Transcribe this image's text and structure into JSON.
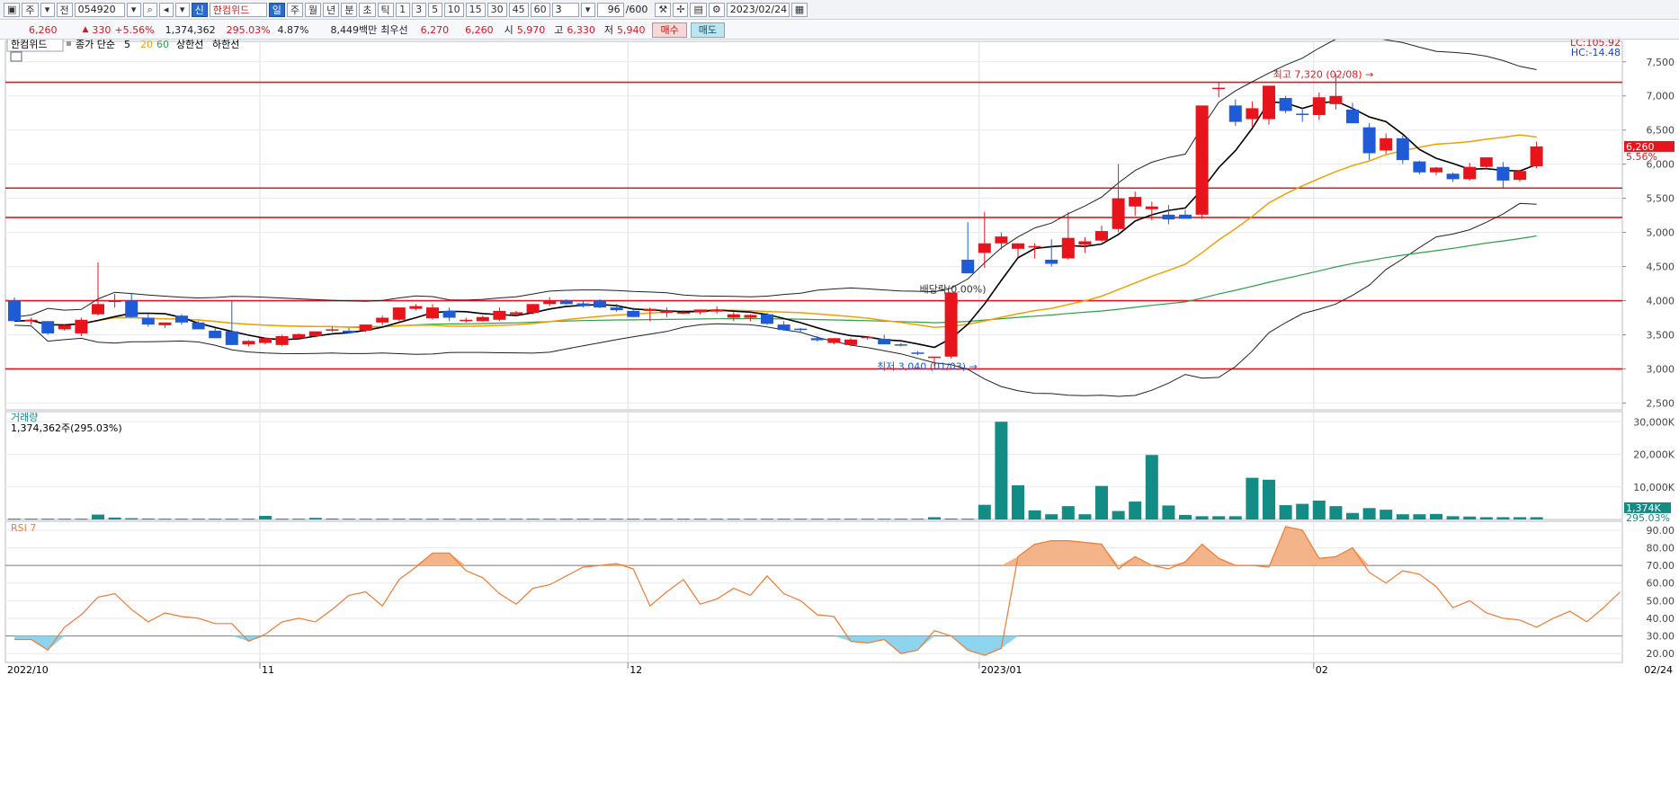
{
  "toolbar": {
    "period_label": "주",
    "jeon_label": "전",
    "code": "054920",
    "sin_label": "신",
    "name": "한컴위드",
    "timeframes": [
      "일",
      "주",
      "월",
      "년",
      "분",
      "초",
      "틱"
    ],
    "minutes": [
      "1",
      "3",
      "5",
      "10",
      "15",
      "30",
      "45",
      "60"
    ],
    "extra": "3",
    "count": "96",
    "count_total": "/600",
    "date": "2023/02/24"
  },
  "quote": {
    "price": "6,260",
    "change_arrow": "▲",
    "change": "330",
    "change_pct": "+5.56%",
    "volume": "1,374,362",
    "volume_ratio": "295.03%",
    "turnover_ratio": "4.87%",
    "amount": "8,449백만",
    "best_label": "최우선",
    "best_ask": "6,270",
    "best_bid": "6,260",
    "open_label": "시",
    "open": "5,970",
    "high_label": "고",
    "high": "6,330",
    "low_label": "저",
    "low": "5,940",
    "buy_button": "매수",
    "sell_button": "매도"
  },
  "colors": {
    "up": "#e8141c",
    "down": "#1f5bd6",
    "ma5": "#000000",
    "ma20": "#f0a000",
    "ma60": "#2e9e4a",
    "band": "#222222",
    "level_line": "#e8141c",
    "volume": "#148c86",
    "rsi": "#f07a30",
    "rsi_over": "#f4b48a",
    "rsi_under": "#8fd4ee"
  },
  "chart_data": {
    "type": "candlestick",
    "legend": {
      "name": "한컴위드",
      "ma_label": "종가 단순",
      "ma_periods": [
        "5",
        "20",
        "60"
      ],
      "upper": "상한선",
      "lower": "하한선"
    },
    "corner": {
      "lc": "LC:105.92",
      "hc": "HC:-14.48"
    },
    "price_axis": {
      "min": 2400,
      "max": 7800,
      "ticks": [
        2500,
        3000,
        3500,
        4000,
        4500,
        5000,
        5500,
        6000,
        6500,
        7000,
        7500
      ],
      "tick_labels": [
        "2,500",
        "3,000",
        "3,500",
        "4,000",
        "4,500",
        "5,000",
        "5,500",
        "6,000",
        "6,500",
        "7,000",
        "7,500"
      ]
    },
    "current_tag": {
      "price": 6260,
      "label": "6,260",
      "pct": "5.56%"
    },
    "x_labels": [
      {
        "label": "2022/10",
        "index": 0
      },
      {
        "label": "11",
        "index": 15
      },
      {
        "label": "12",
        "index": 37
      },
      {
        "label": "2023/01",
        "index": 58
      },
      {
        "label": "02",
        "index": 78
      },
      {
        "label": "02/24",
        "index": 97
      }
    ],
    "level_lines": [
      7200,
      5650,
      5220,
      4000,
      3000
    ],
    "annotations": {
      "high": {
        "text": "최고 7,320 (02/08) →",
        "index": 76,
        "price": 7320
      },
      "low": {
        "text": "최저 3,040 (01/03) →",
        "index": 58,
        "price": 3040
      },
      "dividend": {
        "text": "배당락(0.00%)",
        "index": 56,
        "price": 4120
      }
    },
    "candles": [
      [
        4000,
        4050,
        3700,
        3700
      ],
      [
        3700,
        3750,
        3650,
        3720
      ],
      [
        3700,
        3700,
        3500,
        3520
      ],
      [
        3580,
        3650,
        3560,
        3640
      ],
      [
        3520,
        3750,
        3480,
        3720
      ],
      [
        3800,
        4560,
        3780,
        3950
      ],
      [
        3980,
        4100,
        3900,
        4000
      ],
      [
        4000,
        4100,
        3750,
        3760
      ],
      [
        3750,
        3800,
        3620,
        3650
      ],
      [
        3640,
        3680,
        3600,
        3680
      ],
      [
        3780,
        3800,
        3650,
        3680
      ],
      [
        3680,
        3700,
        3580,
        3580
      ],
      [
        3560,
        3600,
        3450,
        3450
      ],
      [
        3550,
        4000,
        3350,
        3350
      ],
      [
        3360,
        3420,
        3330,
        3410
      ],
      [
        3380,
        3450,
        3360,
        3450
      ],
      [
        3350,
        3500,
        3330,
        3480
      ],
      [
        3450,
        3520,
        3440,
        3510
      ],
      [
        3480,
        3550,
        3460,
        3550
      ],
      [
        3560,
        3620,
        3540,
        3580
      ],
      [
        3560,
        3600,
        3520,
        3530
      ],
      [
        3560,
        3650,
        3540,
        3650
      ],
      [
        3680,
        3780,
        3640,
        3750
      ],
      [
        3720,
        3900,
        3700,
        3900
      ],
      [
        3880,
        3950,
        3860,
        3920
      ],
      [
        3740,
        3950,
        3720,
        3900
      ],
      [
        3850,
        3900,
        3700,
        3750
      ],
      [
        3700,
        3750,
        3680,
        3720
      ],
      [
        3700,
        3780,
        3690,
        3760
      ],
      [
        3720,
        3900,
        3700,
        3850
      ],
      [
        3800,
        3850,
        3780,
        3830
      ],
      [
        3820,
        3950,
        3800,
        3950
      ],
      [
        3950,
        4050,
        3920,
        4000
      ],
      [
        4000,
        4020,
        3940,
        3950
      ],
      [
        3960,
        4000,
        3900,
        3920
      ],
      [
        4000,
        4020,
        3890,
        3900
      ],
      [
        3900,
        3950,
        3840,
        3860
      ],
      [
        3850,
        3900,
        3760,
        3760
      ],
      [
        3850,
        3900,
        3700,
        3880
      ],
      [
        3820,
        3900,
        3760,
        3860
      ],
      [
        3830,
        3860,
        3800,
        3830
      ],
      [
        3830,
        3870,
        3800,
        3870
      ],
      [
        3840,
        3920,
        3810,
        3870
      ],
      [
        3750,
        3830,
        3700,
        3800
      ],
      [
        3750,
        3800,
        3700,
        3790
      ],
      [
        3800,
        3820,
        3650,
        3660
      ],
      [
        3650,
        3700,
        3560,
        3570
      ],
      [
        3590,
        3600,
        3550,
        3570
      ],
      [
        3450,
        3480,
        3400,
        3420
      ],
      [
        3380,
        3450,
        3360,
        3450
      ],
      [
        3350,
        3450,
        3330,
        3430
      ],
      [
        3460,
        3480,
        3430,
        3470
      ],
      [
        3440,
        3500,
        3360,
        3360
      ],
      [
        3360,
        3380,
        3330,
        3350
      ],
      [
        3240,
        3260,
        3200,
        3220
      ],
      [
        3160,
        3180,
        3040,
        3180
      ],
      [
        3180,
        4100,
        3150,
        4120
      ],
      [
        4600,
        5150,
        4500,
        4400
      ],
      [
        4700,
        5300,
        4480,
        4840
      ],
      [
        4840,
        5000,
        4750,
        4940
      ],
      [
        4760,
        4800,
        4640,
        4840
      ],
      [
        4780,
        4840,
        4620,
        4800
      ],
      [
        4600,
        4900,
        4500,
        4540
      ],
      [
        4620,
        5300,
        4600,
        4920
      ],
      [
        4820,
        4930,
        4700,
        4870
      ],
      [
        4880,
        5100,
        4860,
        5020
      ],
      [
        5050,
        6000,
        5000,
        5500
      ],
      [
        5380,
        5600,
        5240,
        5520
      ],
      [
        5340,
        5450,
        5180,
        5380
      ],
      [
        5260,
        5400,
        5120,
        5190
      ],
      [
        5260,
        5330,
        5230,
        5200
      ],
      [
        5260,
        5500,
        5200,
        6860
      ],
      [
        7120,
        7200,
        6980,
        7120
      ],
      [
        6860,
        6950,
        6560,
        6620
      ],
      [
        6660,
        6920,
        6550,
        6820
      ],
      [
        6660,
        7150,
        6580,
        7150
      ],
      [
        6970,
        7000,
        6750,
        6780
      ],
      [
        6740,
        6800,
        6620,
        6720
      ],
      [
        6720,
        7050,
        6650,
        6980
      ],
      [
        6880,
        7320,
        6800,
        7000
      ],
      [
        6800,
        6900,
        6600,
        6600
      ],
      [
        6540,
        6600,
        6060,
        6160
      ],
      [
        6200,
        6450,
        6150,
        6380
      ],
      [
        6380,
        6420,
        6000,
        6060
      ],
      [
        6040,
        6050,
        5850,
        5880
      ],
      [
        5880,
        5960,
        5840,
        5950
      ],
      [
        5860,
        5880,
        5740,
        5780
      ],
      [
        5780,
        6020,
        5760,
        5960
      ],
      [
        5960,
        6100,
        5920,
        6100
      ],
      [
        5960,
        6030,
        5650,
        5760
      ],
      [
        5770,
        5920,
        5740,
        5900
      ],
      [
        5970,
        6330,
        5940,
        6260
      ]
    ],
    "volume_panel": {
      "title": "거래량",
      "info": "1,374,362주(295.03%)",
      "axis_ticks": [
        10000,
        20000,
        30000
      ],
      "tick_labels": [
        "10,000K",
        "20,000K",
        "30,000K"
      ],
      "max": 32000,
      "current_label": "1,374K",
      "current_pct": "295.03%",
      "values": [
        250,
        250,
        250,
        250,
        250,
        1500,
        600,
        400,
        300,
        250,
        250,
        250,
        250,
        250,
        250,
        1100,
        250,
        250,
        500,
        300,
        250,
        250,
        250,
        250,
        250,
        250,
        250,
        250,
        250,
        250,
        250,
        250,
        250,
        250,
        250,
        250,
        250,
        250,
        250,
        250,
        250,
        250,
        250,
        250,
        250,
        250,
        250,
        250,
        250,
        250,
        250,
        250,
        250,
        250,
        250,
        700,
        300,
        250,
        4500,
        30000,
        10500,
        2800,
        1600,
        4100,
        1600,
        10300,
        2600,
        5500,
        19800,
        4300,
        1400,
        1000,
        1000,
        1000,
        12800,
        12200,
        4400,
        4800,
        5800,
        4100,
        2000,
        3500,
        3000,
        1600,
        1600,
        1700,
        1000,
        900,
        700,
        700,
        700,
        700,
        700,
        700,
        700,
        1400
      ]
    },
    "rsi_panel": {
      "title": "RSI 7",
      "axis_ticks": [
        20,
        30,
        40,
        50,
        60,
        70,
        80,
        90
      ],
      "tick_labels": [
        "20.00",
        "30.00",
        "40.00",
        "50.00",
        "60.00",
        "70.00",
        "80.00",
        "90.00"
      ],
      "values": [
        28,
        28,
        22,
        35,
        42,
        52,
        54,
        45,
        38,
        43,
        41,
        40,
        37,
        37,
        27,
        31,
        38,
        40,
        38,
        45,
        53,
        55,
        47,
        62,
        69,
        77,
        77,
        67,
        63,
        54,
        48,
        57,
        59,
        64,
        69,
        70,
        71,
        68,
        47,
        55,
        62,
        48,
        51,
        57,
        53,
        64,
        54,
        50,
        42,
        41,
        27,
        26,
        28,
        20,
        22,
        33,
        30,
        22,
        19,
        23,
        75,
        82,
        84,
        84,
        83,
        82,
        68,
        75,
        70,
        68,
        72,
        82,
        74,
        70,
        70,
        69,
        92,
        90,
        74,
        75,
        80,
        66,
        60,
        67,
        65,
        58,
        46,
        50,
        43,
        40,
        39,
        35,
        40,
        44,
        38,
        46,
        55
      ]
    }
  }
}
